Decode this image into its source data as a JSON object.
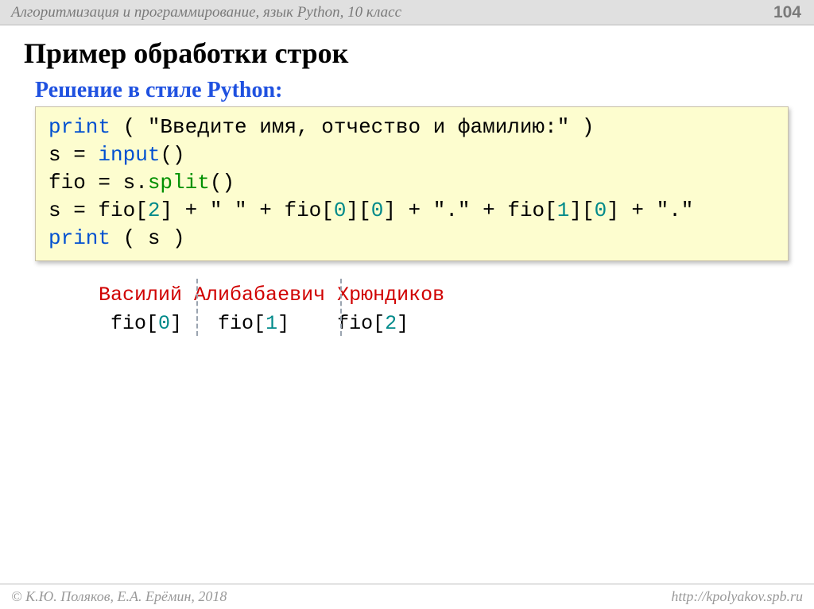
{
  "header": {
    "course_title": "Алгоритмизация и программирование, язык Python, 10 класс",
    "page_number": "104"
  },
  "title": "Пример обработки строк",
  "subtitle": "Решение в стиле Python:",
  "code": {
    "print_kw": "print",
    "l1_arg": " ( \"Введите имя, отчество и фамилию:\" )",
    "l2_pre": "s = ",
    "input_kw": "input",
    "l2_post": "()",
    "l3_pre": "fio = s.",
    "split_kw": "split",
    "l3_post": "()",
    "l4_a": "s = fio[",
    "l4_i2": "2",
    "l4_b": "] + \" \" + fio[",
    "l4_i0a": "0",
    "l4_c": "][",
    "l4_i0b": "0",
    "l4_d": "] + \".\" + fio[",
    "l4_i1": "1",
    "l4_e": "][",
    "l4_i0c": "0",
    "l4_f": "] + \".\"",
    "l5_arg": " ( s )"
  },
  "example": {
    "name1": "Василий",
    "name2": "Алибабаевич",
    "name3": "Хрюндиков",
    "lbl1_a": " fio[",
    "lbl1_i": "0",
    "lbl1_b": "]",
    "lbl2_a": "   fio[",
    "lbl2_i": "1",
    "lbl2_b": "]",
    "lbl3_a": "    fio[",
    "lbl3_i": "2",
    "lbl3_b": "]"
  },
  "footer": {
    "copyright": "© К.Ю. Поляков, Е.А. Ерёмин, 2018",
    "url": "http://kpolyakov.spb.ru"
  }
}
